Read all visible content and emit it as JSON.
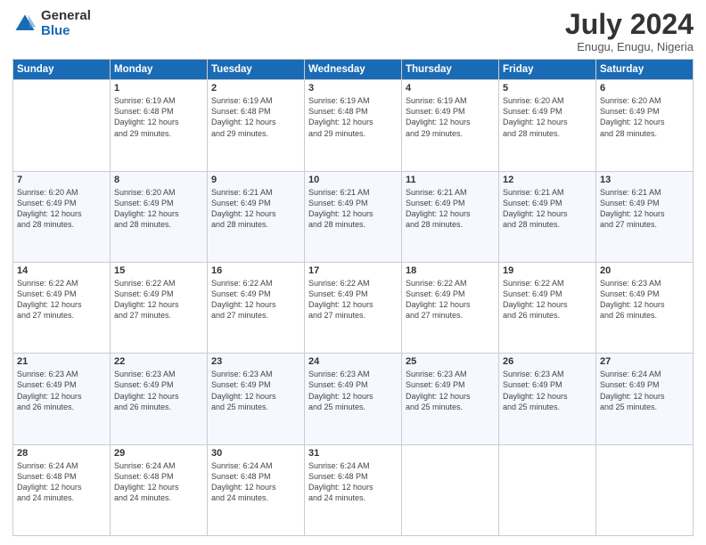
{
  "logo": {
    "general": "General",
    "blue": "Blue"
  },
  "header": {
    "month": "July 2024",
    "location": "Enugu, Enugu, Nigeria"
  },
  "weekdays": [
    "Sunday",
    "Monday",
    "Tuesday",
    "Wednesday",
    "Thursday",
    "Friday",
    "Saturday"
  ],
  "weeks": [
    [
      {
        "day": "",
        "info": ""
      },
      {
        "day": "1",
        "info": "Sunrise: 6:19 AM\nSunset: 6:48 PM\nDaylight: 12 hours\nand 29 minutes."
      },
      {
        "day": "2",
        "info": "Sunrise: 6:19 AM\nSunset: 6:48 PM\nDaylight: 12 hours\nand 29 minutes."
      },
      {
        "day": "3",
        "info": "Sunrise: 6:19 AM\nSunset: 6:48 PM\nDaylight: 12 hours\nand 29 minutes."
      },
      {
        "day": "4",
        "info": "Sunrise: 6:19 AM\nSunset: 6:49 PM\nDaylight: 12 hours\nand 29 minutes."
      },
      {
        "day": "5",
        "info": "Sunrise: 6:20 AM\nSunset: 6:49 PM\nDaylight: 12 hours\nand 28 minutes."
      },
      {
        "day": "6",
        "info": "Sunrise: 6:20 AM\nSunset: 6:49 PM\nDaylight: 12 hours\nand 28 minutes."
      }
    ],
    [
      {
        "day": "7",
        "info": "Sunrise: 6:20 AM\nSunset: 6:49 PM\nDaylight: 12 hours\nand 28 minutes."
      },
      {
        "day": "8",
        "info": "Sunrise: 6:20 AM\nSunset: 6:49 PM\nDaylight: 12 hours\nand 28 minutes."
      },
      {
        "day": "9",
        "info": "Sunrise: 6:21 AM\nSunset: 6:49 PM\nDaylight: 12 hours\nand 28 minutes."
      },
      {
        "day": "10",
        "info": "Sunrise: 6:21 AM\nSunset: 6:49 PM\nDaylight: 12 hours\nand 28 minutes."
      },
      {
        "day": "11",
        "info": "Sunrise: 6:21 AM\nSunset: 6:49 PM\nDaylight: 12 hours\nand 28 minutes."
      },
      {
        "day": "12",
        "info": "Sunrise: 6:21 AM\nSunset: 6:49 PM\nDaylight: 12 hours\nand 28 minutes."
      },
      {
        "day": "13",
        "info": "Sunrise: 6:21 AM\nSunset: 6:49 PM\nDaylight: 12 hours\nand 27 minutes."
      }
    ],
    [
      {
        "day": "14",
        "info": "Sunrise: 6:22 AM\nSunset: 6:49 PM\nDaylight: 12 hours\nand 27 minutes."
      },
      {
        "day": "15",
        "info": "Sunrise: 6:22 AM\nSunset: 6:49 PM\nDaylight: 12 hours\nand 27 minutes."
      },
      {
        "day": "16",
        "info": "Sunrise: 6:22 AM\nSunset: 6:49 PM\nDaylight: 12 hours\nand 27 minutes."
      },
      {
        "day": "17",
        "info": "Sunrise: 6:22 AM\nSunset: 6:49 PM\nDaylight: 12 hours\nand 27 minutes."
      },
      {
        "day": "18",
        "info": "Sunrise: 6:22 AM\nSunset: 6:49 PM\nDaylight: 12 hours\nand 27 minutes."
      },
      {
        "day": "19",
        "info": "Sunrise: 6:22 AM\nSunset: 6:49 PM\nDaylight: 12 hours\nand 26 minutes."
      },
      {
        "day": "20",
        "info": "Sunrise: 6:23 AM\nSunset: 6:49 PM\nDaylight: 12 hours\nand 26 minutes."
      }
    ],
    [
      {
        "day": "21",
        "info": "Sunrise: 6:23 AM\nSunset: 6:49 PM\nDaylight: 12 hours\nand 26 minutes."
      },
      {
        "day": "22",
        "info": "Sunrise: 6:23 AM\nSunset: 6:49 PM\nDaylight: 12 hours\nand 26 minutes."
      },
      {
        "day": "23",
        "info": "Sunrise: 6:23 AM\nSunset: 6:49 PM\nDaylight: 12 hours\nand 25 minutes."
      },
      {
        "day": "24",
        "info": "Sunrise: 6:23 AM\nSunset: 6:49 PM\nDaylight: 12 hours\nand 25 minutes."
      },
      {
        "day": "25",
        "info": "Sunrise: 6:23 AM\nSunset: 6:49 PM\nDaylight: 12 hours\nand 25 minutes."
      },
      {
        "day": "26",
        "info": "Sunrise: 6:23 AM\nSunset: 6:49 PM\nDaylight: 12 hours\nand 25 minutes."
      },
      {
        "day": "27",
        "info": "Sunrise: 6:24 AM\nSunset: 6:49 PM\nDaylight: 12 hours\nand 25 minutes."
      }
    ],
    [
      {
        "day": "28",
        "info": "Sunrise: 6:24 AM\nSunset: 6:48 PM\nDaylight: 12 hours\nand 24 minutes."
      },
      {
        "day": "29",
        "info": "Sunrise: 6:24 AM\nSunset: 6:48 PM\nDaylight: 12 hours\nand 24 minutes."
      },
      {
        "day": "30",
        "info": "Sunrise: 6:24 AM\nSunset: 6:48 PM\nDaylight: 12 hours\nand 24 minutes."
      },
      {
        "day": "31",
        "info": "Sunrise: 6:24 AM\nSunset: 6:48 PM\nDaylight: 12 hours\nand 24 minutes."
      },
      {
        "day": "",
        "info": ""
      },
      {
        "day": "",
        "info": ""
      },
      {
        "day": "",
        "info": ""
      }
    ]
  ]
}
